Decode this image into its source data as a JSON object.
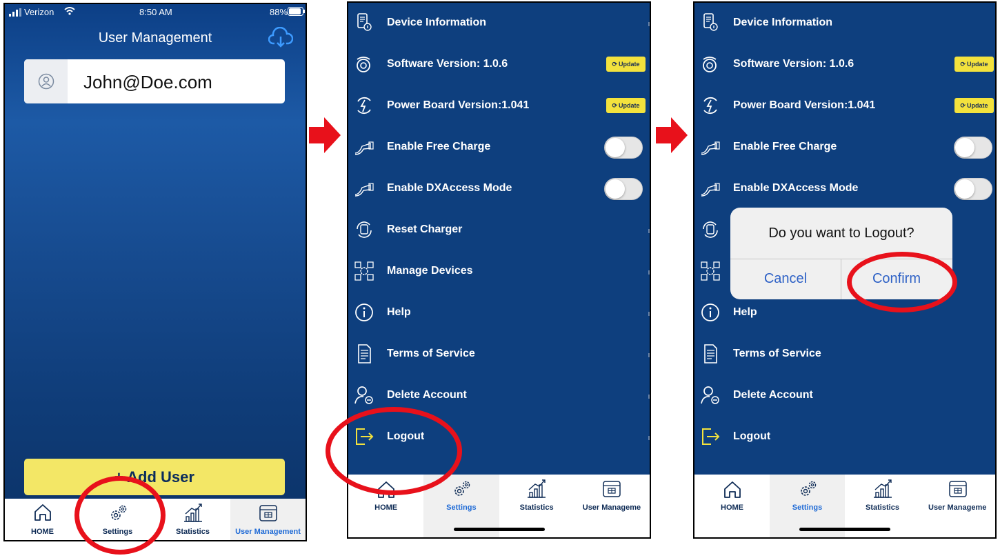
{
  "panel1": {
    "status": {
      "carrier": "Verizon",
      "time": "8:50 AM",
      "battery": "88%"
    },
    "title": "User Management",
    "user_email": "John@Doe.com",
    "add_user_label": "+ Add User",
    "tabs": [
      {
        "label": "HOME",
        "icon": "home-icon"
      },
      {
        "label": "Settings",
        "icon": "gear-icon"
      },
      {
        "label": "Statistics",
        "icon": "statistics-icon"
      },
      {
        "label": "User Management",
        "icon": "user-management-icon"
      }
    ],
    "active_tab": "User Management"
  },
  "panel2": {
    "items": [
      {
        "label": "Device Information",
        "icon": "device-info-icon"
      },
      {
        "label": "Software Version: 1.0.6",
        "icon": "software-icon",
        "action": "Update"
      },
      {
        "label": "Power Board Version:1.041",
        "icon": "power-board-icon",
        "action": "Update"
      },
      {
        "label": "Enable Free Charge",
        "icon": "charger-icon",
        "toggle": false
      },
      {
        "label": "Enable DXAccess Mode",
        "icon": "charger-icon",
        "toggle": false
      },
      {
        "label": "Reset Charger",
        "icon": "reset-icon"
      },
      {
        "label": "Manage Devices",
        "icon": "manage-devices-icon"
      },
      {
        "label": "Help",
        "icon": "info-icon"
      },
      {
        "label": "Terms of Service",
        "icon": "document-icon"
      },
      {
        "label": "Delete Account",
        "icon": "delete-user-icon"
      },
      {
        "label": "Logout",
        "icon": "logout-icon"
      }
    ],
    "tabs": [
      {
        "label": "HOME"
      },
      {
        "label": "Settings"
      },
      {
        "label": "Statistics"
      },
      {
        "label": "User Manageme"
      }
    ],
    "active_tab": "Settings"
  },
  "panel3": {
    "dialog": {
      "question": "Do you want to Logout?",
      "cancel": "Cancel",
      "confirm": "Confirm"
    }
  },
  "colors": {
    "navy": "#0e3f7e",
    "accent_yellow": "#f3e766",
    "highlight_red": "#e8111b",
    "logout_yellow": "#f3e23d",
    "dialog_button_blue": "#2f62c6"
  }
}
